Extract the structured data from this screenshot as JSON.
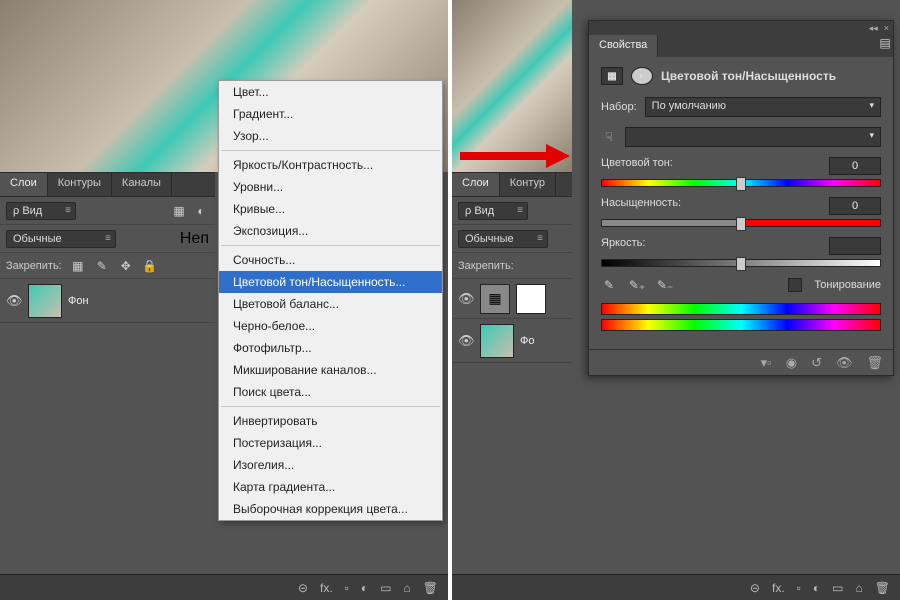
{
  "layers_panel": {
    "tabs": [
      "Слои",
      "Контуры",
      "Каналы"
    ],
    "view": "Вид",
    "blend": "Обычные",
    "opacity_label": "Неп",
    "lock_label": "Закрепить:",
    "layer_bg": "Фон"
  },
  "menu": {
    "groups": [
      [
        "Цвет...",
        "Градиент...",
        "Узор..."
      ],
      [
        "Яркость/Контрастность...",
        "Уровни...",
        "Кривые...",
        "Экспозиция..."
      ],
      [
        "Сочность...",
        "Цветовой тон/Насыщенность...",
        "Цветовой баланс...",
        "Черно-белое...",
        "Фотофильтр...",
        "Микширование каналов...",
        "Поиск цвета..."
      ],
      [
        "Инвертировать",
        "Постеризация...",
        "Изогелия...",
        "Карта градиента...",
        "Выборочная коррекция цвета..."
      ]
    ],
    "selected": "Цветовой тон/Насыщенность..."
  },
  "properties": {
    "tab": "Свойства",
    "title": "Цветовой тон/Насыщенность",
    "preset_label": "Набор:",
    "preset_value": "По умолчанию",
    "range_value": "",
    "hue_label": "Цветовой тон:",
    "hue_value": "0",
    "sat_label": "Насыщенность:",
    "sat_value": "0",
    "light_label": "Яркость:",
    "light_value": "",
    "colorize_label": "Тонирование"
  },
  "status_icons": [
    "⊝",
    "fx.",
    "▫",
    "◐",
    "▭",
    "⌂",
    "🗑"
  ]
}
